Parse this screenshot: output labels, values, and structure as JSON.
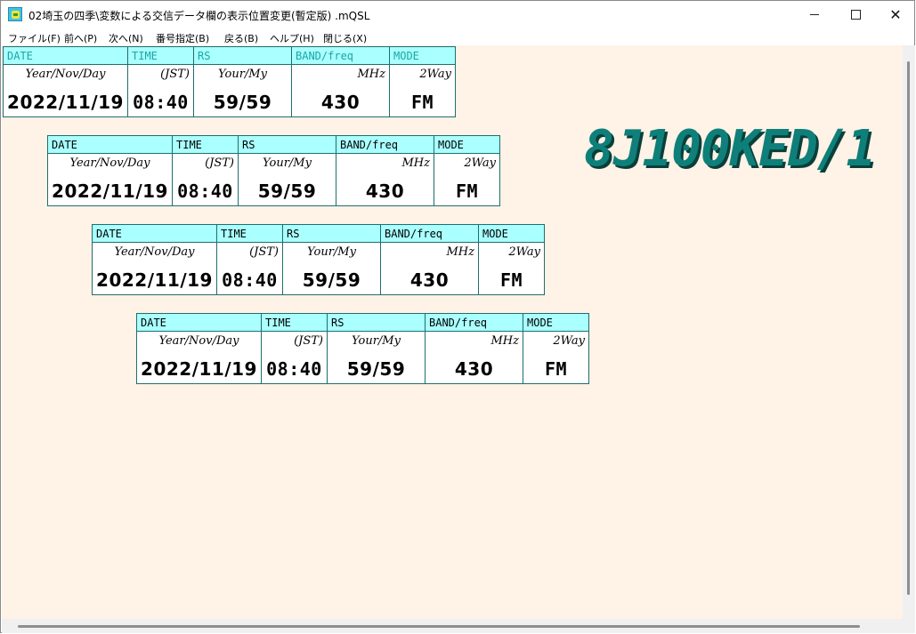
{
  "window": {
    "title": "02埼玉の四季\\変数による交信データ欄の表示位置変更(暫定版) .mQSL",
    "minimize_label": "",
    "maximize_label": "",
    "close_label": "✕"
  },
  "menu": [
    "ファイル(F)",
    "前へ(P)",
    "次へ(N)",
    "番号指定(B)",
    "戻る(B)",
    "ヘルプ(H)",
    "閉じる(X)"
  ],
  "callsign": "8J100KED/1",
  "qsl_headers": {
    "date": "DATE",
    "time": "TIME",
    "rs": "RS",
    "band": "BAND/freq",
    "mode": "MODE"
  },
  "qsl_subheaders": {
    "date": "Year/Nov/Day",
    "time": "(JST)",
    "rs": "Your/My",
    "band": "MHz",
    "mode": "2Way"
  },
  "qsl_values": {
    "date": "2022/11/19",
    "time": "08:40",
    "rs": "59/59",
    "band": "430",
    "mode": "FM"
  },
  "colors": {
    "canvas_bg": "#fff2e6",
    "header_bg": "#aaffff",
    "callsign": "#0f7f7a"
  }
}
